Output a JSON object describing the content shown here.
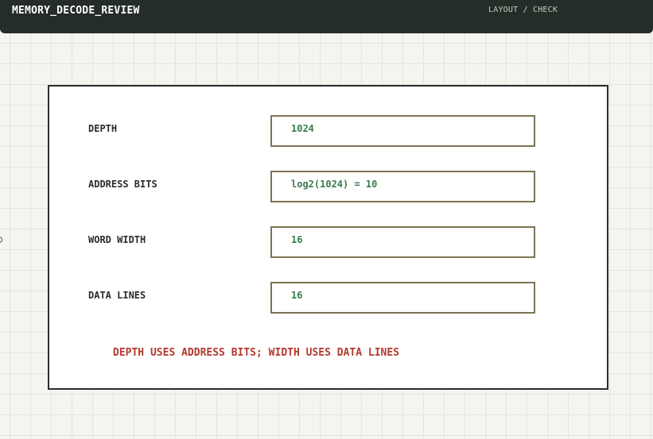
{
  "header": {
    "title": "MEMORY_DECODE_REVIEW",
    "nav": "LAYOUT / CHECK"
  },
  "panel": {
    "rows": [
      {
        "label": "DEPTH",
        "value": "1024"
      },
      {
        "label": "ADDRESS BITS",
        "value": "log2(1024) = 10"
      },
      {
        "label": "WORD WIDTH",
        "value": "16"
      },
      {
        "label": "DATA LINES",
        "value": "16"
      }
    ],
    "note": "DEPTH USES ADDRESS BITS; WIDTH USES DATA LINES"
  },
  "colors": {
    "header_bg": "#252d28",
    "value_text": "#3a7a50",
    "note_text": "#b23a2e",
    "field_border": "#7b7355"
  }
}
